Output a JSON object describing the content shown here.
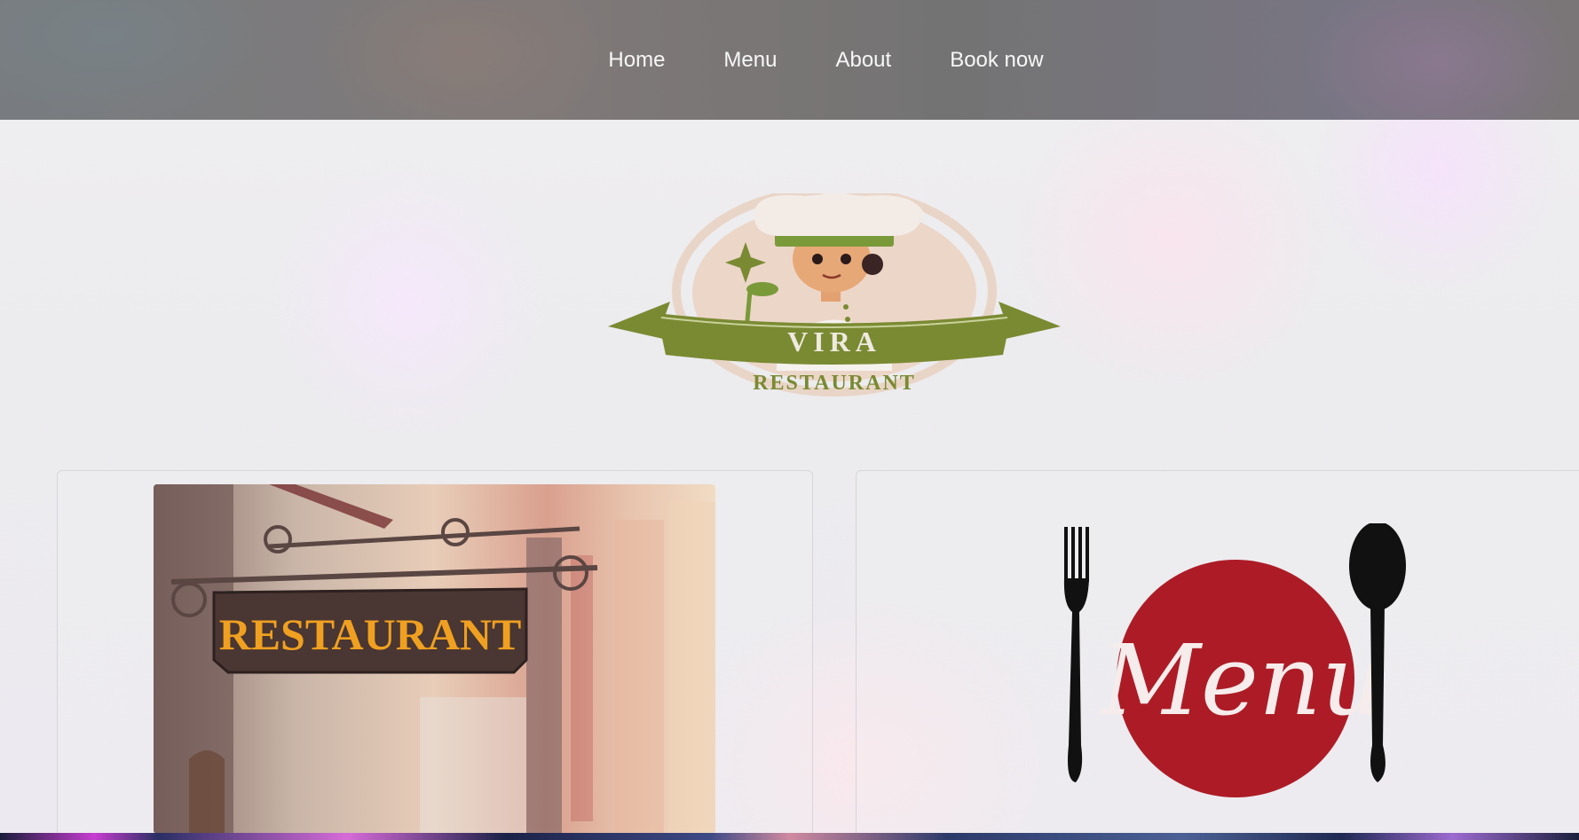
{
  "nav": {
    "items": [
      {
        "label": "Home"
      },
      {
        "label": "Menu"
      },
      {
        "label": "About"
      },
      {
        "label": "Book now"
      }
    ]
  },
  "logo": {
    "name": "VIRA",
    "subtitle": "RESTAURANT",
    "icon": "chef-mascot-icon",
    "colors": {
      "ribbon": "#7a8a32",
      "hat": "#f3ece6",
      "ring": "#e4c8b6"
    }
  },
  "cards": {
    "left": {
      "image_icon": "restaurant-sign-photo",
      "sign_text": "RESTAURANT",
      "sign_color": "#f0a020"
    },
    "right": {
      "image_icon": "menu-plate-icon",
      "plate_text": "Menu",
      "plate_color": "#ad1c26"
    }
  }
}
